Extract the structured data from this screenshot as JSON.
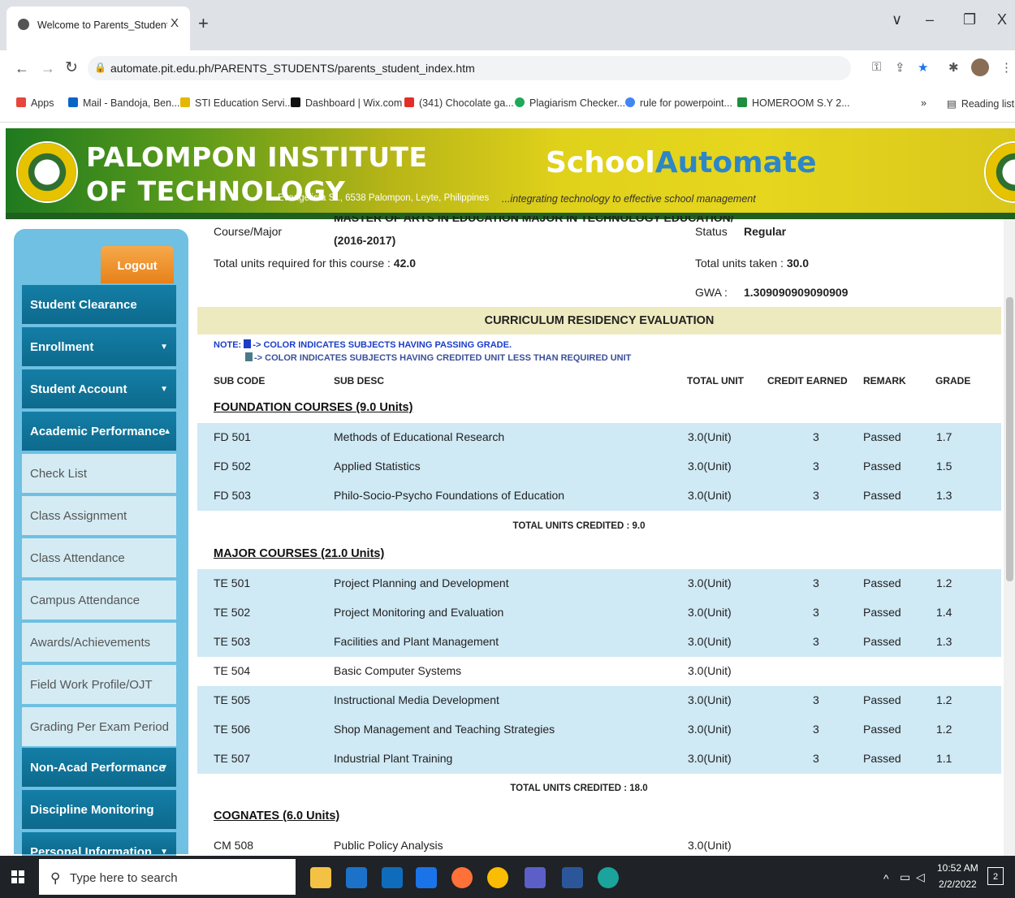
{
  "browser": {
    "tab_title": "Welcome to Parents_Students Pa",
    "tab_close": "X",
    "new_tab": "+",
    "url": "automate.pit.edu.ph/PARENTS_STUDENTS/parents_student_index.htm",
    "win_dropdown": "∨",
    "win_min": "–",
    "win_max": "❐",
    "win_close": "X",
    "bookmarks": [
      {
        "label": "Apps",
        "color": "#e8453c"
      },
      {
        "label": "Mail - Bandoja, Ben...",
        "color": "#0a64c8"
      },
      {
        "label": "STI Education Servi...",
        "color": "#e5b700"
      },
      {
        "label": "Dashboard | Wix.com",
        "color": "#111111"
      },
      {
        "label": "(341) Chocolate ga...",
        "color": "#e52d27"
      },
      {
        "label": "Plagiarism Checker...",
        "color": "#20a85a"
      },
      {
        "label": "rule for powerpoint...",
        "color": "#4285f4"
      },
      {
        "label": "HOMEROOM S.Y 2...",
        "color": "#1e8e3e"
      }
    ],
    "more_bookmarks": "»",
    "reading_list": "Reading list"
  },
  "banner": {
    "institution_line1": "PALOMPON INSTITUTE",
    "institution_line2": "OF TECHNOLOGY",
    "address": "Evangelista St., 6538 Palompon, Leyte, Philippines",
    "logo_part1": "School",
    "logo_part2": "Automate",
    "tagline": "...integrating technology to effective school management"
  },
  "sidebar": {
    "logout": "Logout",
    "main_items": [
      {
        "label": "Student Clearance",
        "caret": ""
      },
      {
        "label": "Enrollment",
        "caret": "▼"
      },
      {
        "label": "Student Account",
        "caret": "▼"
      },
      {
        "label": "Academic Performance",
        "caret": "▲"
      }
    ],
    "sub_items": [
      "Check List",
      "Class Assignment",
      "Class Attendance",
      "Campus Attendance",
      "Awards/Achievements",
      "Field Work Profile/OJT",
      "Grading Per Exam Period"
    ],
    "bottom_items": [
      {
        "label": "Non-Acad Performance",
        "caret": "▼"
      },
      {
        "label": "Discipline Monitoring",
        "caret": ""
      },
      {
        "label": "Personal Information",
        "caret": "▼"
      }
    ]
  },
  "summary": {
    "course_label": "Course/Major",
    "course_value_line1": "MASTER OF ARTS IN EDUCATION MAJOR IN TECHNOLOGY EDUCATION/",
    "course_value_line2": "(2016-2017)",
    "status_label": "Status",
    "status_value": "Regular",
    "units_required_label": "Total units required for this course :",
    "units_required_value": "42.0",
    "units_taken_label": "Total units taken :",
    "units_taken_value": "30.0",
    "gwa_label": "GWA :",
    "gwa_value": "1.309090909090909"
  },
  "evaluation": {
    "title": "CURRICULUM RESIDENCY EVALUATION",
    "note_prefix": "NOTE:",
    "note1": "-> COLOR INDICATES SUBJECTS HAVING PASSING GRADE.",
    "note2": "-> COLOR INDICATES SUBJECTS HAVING CREDITED UNIT LESS THAN REQUIRED UNIT",
    "note1_color": "#1b3cc9",
    "note2_color": "#4a7a8a",
    "columns": [
      "SUB CODE",
      "SUB DESC",
      "TOTAL UNIT",
      "CREDIT EARNED",
      "REMARK",
      "GRADE"
    ]
  },
  "sections": [
    {
      "title": "FOUNDATION COURSES (9.0 Units)",
      "rows": [
        {
          "code": "FD 501",
          "desc": "Methods of Educational Research",
          "unit": "3.0(Unit)",
          "credit": "3",
          "remark": "Passed",
          "grade": "1.7"
        },
        {
          "code": "FD 502",
          "desc": "Applied Statistics",
          "unit": "3.0(Unit)",
          "credit": "3",
          "remark": "Passed",
          "grade": "1.5"
        },
        {
          "code": "FD 503",
          "desc": "Philo-Socio-Psycho Foundations of Education",
          "unit": "3.0(Unit)",
          "credit": "3",
          "remark": "Passed",
          "grade": "1.3"
        }
      ],
      "total": "TOTAL UNITS CREDITED : 9.0"
    },
    {
      "title": "MAJOR COURSES (21.0 Units)",
      "rows": [
        {
          "code": "TE 501",
          "desc": "Project Planning and Development",
          "unit": "3.0(Unit)",
          "credit": "3",
          "remark": "Passed",
          "grade": "1.2"
        },
        {
          "code": "TE 502",
          "desc": "Project Monitoring and Evaluation",
          "unit": "3.0(Unit)",
          "credit": "3",
          "remark": "Passed",
          "grade": "1.4"
        },
        {
          "code": "TE 503",
          "desc": "Facilities and Plant Management",
          "unit": "3.0(Unit)",
          "credit": "3",
          "remark": "Passed",
          "grade": "1.3"
        },
        {
          "code": "TE 504",
          "desc": "Basic Computer Systems",
          "unit": "3.0(Unit)",
          "credit": "",
          "remark": "",
          "grade": ""
        },
        {
          "code": "TE 505",
          "desc": "Instructional Media Development",
          "unit": "3.0(Unit)",
          "credit": "3",
          "remark": "Passed",
          "grade": "1.2"
        },
        {
          "code": "TE 506",
          "desc": "Shop Management and Teaching Strategies",
          "unit": "3.0(Unit)",
          "credit": "3",
          "remark": "Passed",
          "grade": "1.2"
        },
        {
          "code": "TE 507",
          "desc": "Industrial Plant Training",
          "unit": "3.0(Unit)",
          "credit": "3",
          "remark": "Passed",
          "grade": "1.1"
        }
      ],
      "total": "TOTAL UNITS CREDITED : 18.0"
    },
    {
      "title": "COGNATES (6.0 Units)",
      "rows": [
        {
          "code": "CM 508",
          "desc": "Public Policy Analysis",
          "unit": "3.0(Unit)",
          "credit": "",
          "remark": "",
          "grade": ""
        }
      ],
      "total": ""
    }
  ],
  "taskbar": {
    "search_placeholder": "Type here to search",
    "time": "10:52 AM",
    "date": "2/2/2022",
    "notification_count": "2",
    "apps": [
      {
        "name": "file-explorer-icon",
        "color": "#f3c244"
      },
      {
        "name": "store-icon",
        "color": "#1b72c8"
      },
      {
        "name": "outlook-icon",
        "color": "#0f6cbd"
      },
      {
        "name": "mail-icon",
        "color": "#1a73e8"
      },
      {
        "name": "firefox-icon",
        "color": "#ff7139"
      },
      {
        "name": "chrome-icon",
        "color": "#fbbc04"
      },
      {
        "name": "teams-icon",
        "color": "#5b5fc7"
      },
      {
        "name": "word-icon",
        "color": "#2b579a"
      },
      {
        "name": "edge-icon",
        "color": "#1ba39c"
      }
    ]
  }
}
